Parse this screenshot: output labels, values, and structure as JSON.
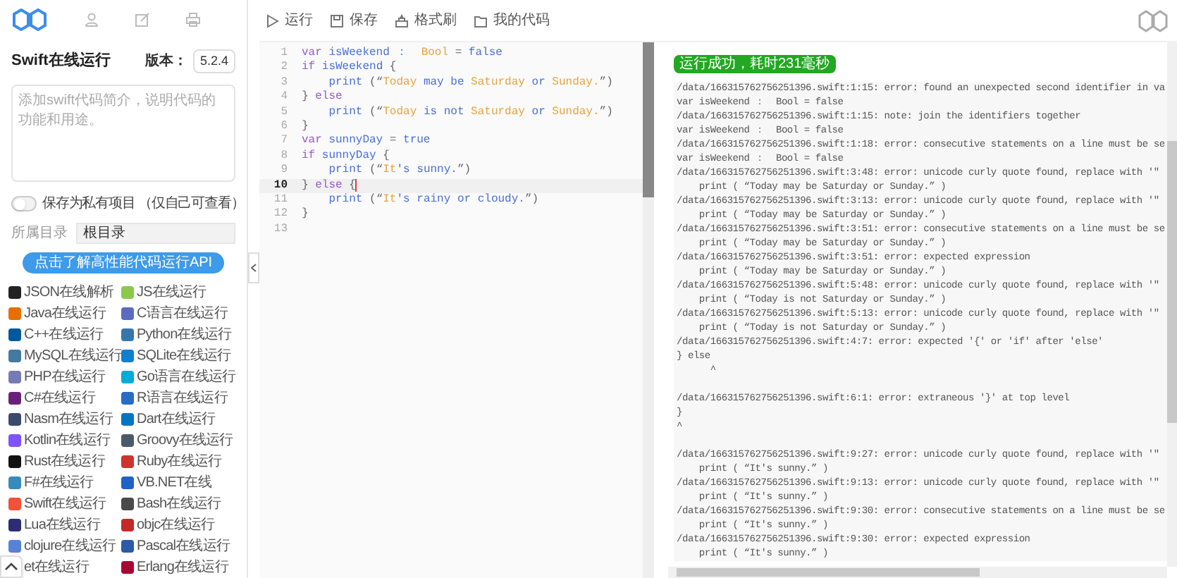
{
  "sidebar": {
    "title": "Swift在线运行",
    "version_label": "版本：",
    "version": "5.2.4",
    "description": {
      "placeholder": "添加swift代码简介，说明代码的功能和用途。"
    },
    "private_toggle": {
      "label": "保存为私有项目 （仅自己可查看）",
      "on": false
    },
    "directory": {
      "label": "所属目录",
      "value": "根目录"
    },
    "api_button": "点击了解高性能代码运行API",
    "languages": [
      {
        "label": "JSON在线解析",
        "color": "#222222"
      },
      {
        "label": "JS在线运行",
        "color": "#8cc84b"
      },
      {
        "label": "Java在线运行",
        "color": "#e76f00"
      },
      {
        "label": "C语言在线运行",
        "color": "#5c6bc0"
      },
      {
        "label": "C++在线运行",
        "color": "#00599c"
      },
      {
        "label": "Python在线运行",
        "color": "#3776ab"
      },
      {
        "label": "MySQL在线运行",
        "color": "#4479a1"
      },
      {
        "label": "SQLite在线运行",
        "color": "#0f80cc"
      },
      {
        "label": "PHP在线运行",
        "color": "#777bb3"
      },
      {
        "label": "Go语言在线运行",
        "color": "#00add8"
      },
      {
        "label": "C#在线运行",
        "color": "#68217a"
      },
      {
        "label": "R语言在线运行",
        "color": "#276dc3"
      },
      {
        "label": "Nasm在线运行",
        "color": "#3a4a6b"
      },
      {
        "label": "Dart在线运行",
        "color": "#0175c2"
      },
      {
        "label": "Kotlin在线运行",
        "color": "#7f52ff"
      },
      {
        "label": "Groovy在线运行",
        "color": "#4a5a6a"
      },
      {
        "label": "Rust在线运行",
        "color": "#111111"
      },
      {
        "label": "Ruby在线运行",
        "color": "#cc342d"
      },
      {
        "label": "F#在线运行",
        "color": "#378bba"
      },
      {
        "label": "VB.NET在线",
        "color": "#1e63c4"
      },
      {
        "label": "Swift在线运行",
        "color": "#f05138"
      },
      {
        "label": "Bash在线运行",
        "color": "#4a4a4a"
      },
      {
        "label": "Lua在线运行",
        "color": "#2c2d72"
      },
      {
        "label": "objc在线运行",
        "color": "#c62828"
      },
      {
        "label": "clojure在线运行",
        "color": "#5881d8"
      },
      {
        "label": "Pascal在线运行",
        "color": "#2a5aa8"
      },
      {
        "label": "et在线运行"
      },
      {
        "label": "Erlang在线运行",
        "color": "#a90533"
      }
    ]
  },
  "toolbar": [
    {
      "kind": "run",
      "label": "运行"
    },
    {
      "kind": "save",
      "label": "保存"
    },
    {
      "kind": "format",
      "label": "格式刷"
    },
    {
      "kind": "folder",
      "label": "我的代码"
    }
  ],
  "editor": {
    "lines": [
      {
        "number": "1",
        "active": false,
        "tokens": [
          {
            "kind": "kw",
            "text": "var "
          },
          {
            "kind": "id",
            "text": "isWeekend ：  "
          },
          {
            "kind": "str",
            "text": "Bool"
          },
          {
            "kind": "op",
            "text": " = "
          },
          {
            "kind": "id",
            "text": "false"
          }
        ]
      },
      {
        "number": "2",
        "active": false,
        "tokens": [
          {
            "kind": "kw",
            "text": "if "
          },
          {
            "kind": "id",
            "text": "isWeekend "
          },
          {
            "kind": "op",
            "text": "{"
          }
        ]
      },
      {
        "number": "3",
        "active": false,
        "tokens": [
          {
            "kind": "id",
            "text": "    print "
          },
          {
            "kind": "op",
            "text": "(“"
          },
          {
            "kind": "str",
            "text": "Today "
          },
          {
            "kind": "id",
            "text": "may be "
          },
          {
            "kind": "str",
            "text": "Saturday "
          },
          {
            "kind": "id",
            "text": "or "
          },
          {
            "kind": "str",
            "text": "Sunday."
          },
          {
            "kind": "op",
            "text": "”)"
          }
        ]
      },
      {
        "number": "4",
        "active": false,
        "tokens": [
          {
            "kind": "op",
            "text": "} "
          },
          {
            "kind": "kw",
            "text": "else"
          }
        ]
      },
      {
        "number": "5",
        "active": false,
        "tokens": [
          {
            "kind": "id",
            "text": "    print "
          },
          {
            "kind": "op",
            "text": "(“"
          },
          {
            "kind": "str",
            "text": "Today "
          },
          {
            "kind": "id",
            "text": "is not "
          },
          {
            "kind": "str",
            "text": "Saturday "
          },
          {
            "kind": "id",
            "text": "or "
          },
          {
            "kind": "str",
            "text": "Sunday."
          },
          {
            "kind": "op",
            "text": "”)"
          }
        ]
      },
      {
        "number": "6",
        "active": false,
        "tokens": [
          {
            "kind": "op",
            "text": "}"
          }
        ]
      },
      {
        "number": "7",
        "active": false,
        "tokens": [
          {
            "kind": "kw",
            "text": "var "
          },
          {
            "kind": "id",
            "text": "sunnyDay "
          },
          {
            "kind": "op",
            "text": "= "
          },
          {
            "kind": "id",
            "text": "true"
          }
        ]
      },
      {
        "number": "8",
        "active": false,
        "tokens": [
          {
            "kind": "kw",
            "text": "if "
          },
          {
            "kind": "id",
            "text": "sunnyDay "
          },
          {
            "kind": "op",
            "text": "{"
          }
        ]
      },
      {
        "number": "9",
        "active": false,
        "tokens": [
          {
            "kind": "id",
            "text": "    print "
          },
          {
            "kind": "op",
            "text": "(“"
          },
          {
            "kind": "str",
            "text": "It"
          },
          {
            "kind": "id",
            "text": "'s sunny."
          },
          {
            "kind": "op",
            "text": "”)"
          }
        ]
      },
      {
        "number": "10",
        "active": true,
        "tokens": [
          {
            "kind": "op",
            "text": "} "
          },
          {
            "kind": "kw",
            "text": "else "
          },
          {
            "kind": "op",
            "text": "{"
          }
        ]
      },
      {
        "number": "11",
        "active": false,
        "tokens": [
          {
            "kind": "id",
            "text": "    print "
          },
          {
            "kind": "op",
            "text": "(“"
          },
          {
            "kind": "str",
            "text": "It"
          },
          {
            "kind": "id",
            "text": "'s rainy or cloudy."
          },
          {
            "kind": "op",
            "text": "”)"
          }
        ]
      },
      {
        "number": "12",
        "active": false,
        "tokens": [
          {
            "kind": "op",
            "text": "}"
          }
        ]
      },
      {
        "number": "13",
        "active": false
      }
    ]
  },
  "output": {
    "status": "运行成功，耗时231毫秒",
    "lines": [
      {
        "kind": "message",
        "text": "/data/166315762756251396.swift:1:15: error: found an unexpected second identifier in va"
      },
      {
        "kind": "source",
        "text": "var isWeekend ：  Bool = false"
      },
      {
        "kind": "message",
        "text": "/data/166315762756251396.swift:1:15: note: join the identifiers together"
      },
      {
        "kind": "source",
        "text": "var isWeekend ：  Bool = false"
      },
      {
        "kind": "message",
        "text": "/data/166315762756251396.swift:1:18: error: consecutive statements on a line must be se"
      },
      {
        "kind": "source",
        "text": "var isWeekend ：  Bool = false"
      },
      {
        "kind": "message",
        "text": "/data/166315762756251396.swift:3:48: error: unicode curly quote found, replace with '\""
      },
      {
        "kind": "source",
        "text": "    print ( “Today may be Saturday or Sunday.” )"
      },
      {
        "kind": "message",
        "text": "/data/166315762756251396.swift:3:13: error: unicode curly quote found, replace with '\""
      },
      {
        "kind": "source",
        "text": "    print ( “Today may be Saturday or Sunday.” )"
      },
      {
        "kind": "message",
        "text": "/data/166315762756251396.swift:3:51: error: consecutive statements on a line must be se"
      },
      {
        "kind": "source",
        "text": "    print ( “Today may be Saturday or Sunday.” )"
      },
      {
        "kind": "message",
        "text": "/data/166315762756251396.swift:3:51: error: expected expression"
      },
      {
        "kind": "source",
        "text": "    print ( “Today may be Saturday or Sunday.” )"
      },
      {
        "kind": "message",
        "text": "/data/166315762756251396.swift:5:48: error: unicode curly quote found, replace with '\""
      },
      {
        "kind": "source",
        "text": "    print ( “Today is not Saturday or Sunday.” )"
      },
      {
        "kind": "message",
        "text": "/data/166315762756251396.swift:5:13: error: unicode curly quote found, replace with '\""
      },
      {
        "kind": "source",
        "text": "    print ( “Today is not Saturday or Sunday.” )"
      },
      {
        "kind": "message",
        "text": "/data/166315762756251396.swift:4:7: error: expected '{' or 'if' after 'else'"
      },
      {
        "kind": "source",
        "text": "} else"
      },
      {
        "kind": "caret",
        "text": "      ^"
      },
      {
        "kind": "message",
        "text": "/data/166315762756251396.swift:6:1: error: extraneous '}' at top level"
      },
      {
        "kind": "source",
        "text": "}"
      },
      {
        "kind": "caret",
        "text": "^"
      },
      {
        "kind": "message",
        "text": "/data/166315762756251396.swift:9:27: error: unicode curly quote found, replace with '\""
      },
      {
        "kind": "source",
        "text": "    print ( “It's sunny.” )"
      },
      {
        "kind": "message",
        "text": "/data/166315762756251396.swift:9:13: error: unicode curly quote found, replace with '\""
      },
      {
        "kind": "source",
        "text": "    print ( “It's sunny.” )"
      },
      {
        "kind": "message",
        "text": "/data/166315762756251396.swift:9:30: error: consecutive statements on a line must be se"
      },
      {
        "kind": "source",
        "text": "    print ( “It's sunny.” )"
      },
      {
        "kind": "message",
        "text": "/data/166315762756251396.swift:9:30: error: expected expression"
      },
      {
        "kind": "source",
        "text": "    print ( “It's sunny.” )"
      }
    ]
  }
}
